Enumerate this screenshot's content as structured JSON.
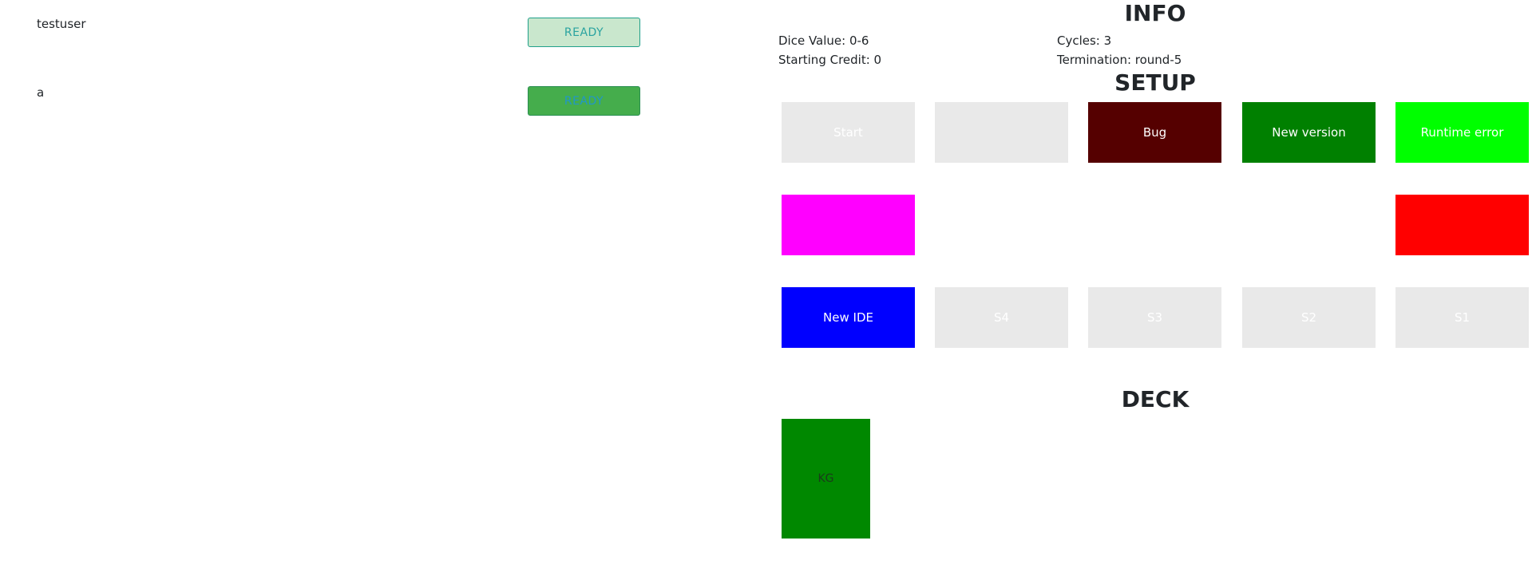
{
  "players": [
    {
      "name": "testuser",
      "button_label": "READY"
    },
    {
      "name": "a",
      "button_label": "READY"
    }
  ],
  "info": {
    "heading": "INFO",
    "dice_value": "Dice Value: 0-6",
    "starting_credit": "Starting Credit: 0",
    "cycles": "Cycles: 3",
    "termination": "Termination: round-5"
  },
  "setup": {
    "heading": "SETUP",
    "cells": [
      {
        "label": "Start",
        "color": "#e9e9e9"
      },
      {
        "label": "",
        "color": "#e9e9e9"
      },
      {
        "label": "Bug",
        "color": "#550000"
      },
      {
        "label": "New version",
        "color": "#008000"
      },
      {
        "label": "Runtime error",
        "color": "#00ff00"
      },
      {
        "label": "",
        "color": "#ff00ff"
      },
      {
        "label": "",
        "color": "#ff0000"
      },
      {
        "label": "New IDE",
        "color": "#0000ff"
      },
      {
        "label": "S4",
        "color": "#e9e9e9"
      },
      {
        "label": "S3",
        "color": "#e9e9e9"
      },
      {
        "label": "S2",
        "color": "#e9e9e9"
      },
      {
        "label": "S1",
        "color": "#e9e9e9"
      }
    ]
  },
  "deck": {
    "heading": "DECK",
    "cards": [
      {
        "label": "KG",
        "color": "#008800"
      }
    ]
  }
}
